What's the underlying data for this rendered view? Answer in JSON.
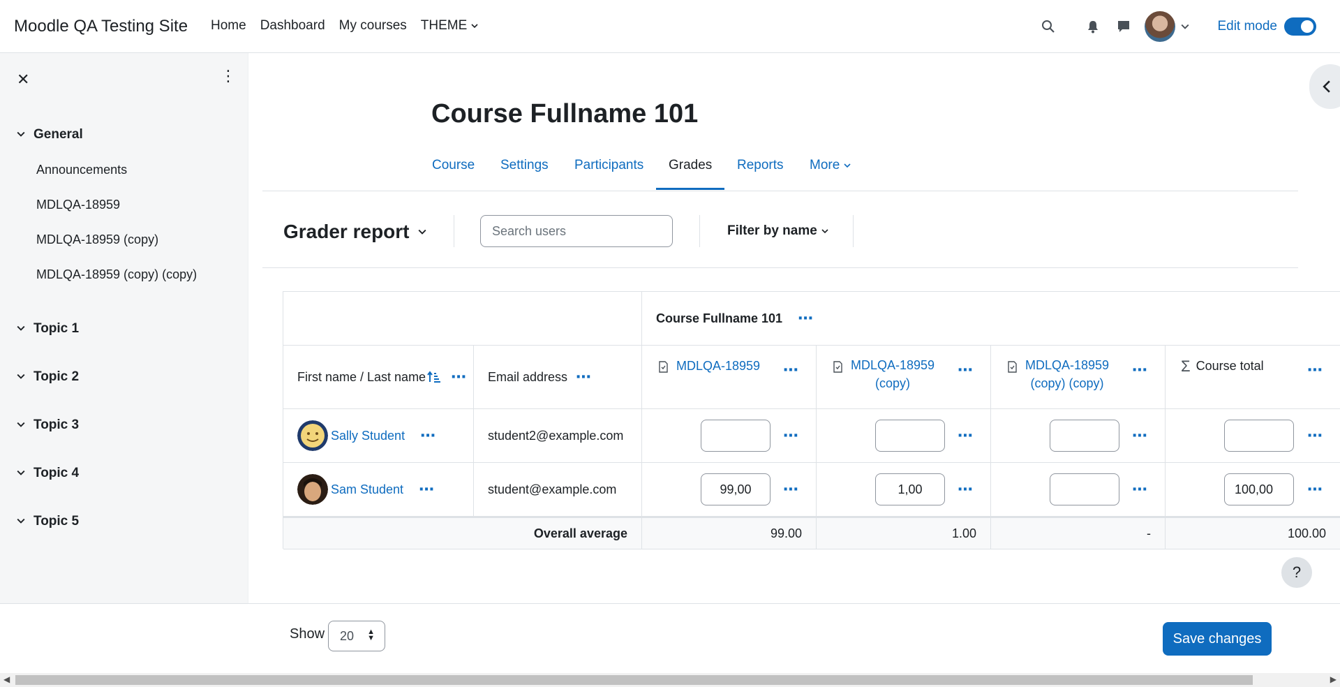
{
  "navbar": {
    "site_name": "Moodle QA Testing Site",
    "links": [
      "Home",
      "Dashboard",
      "My courses"
    ],
    "theme_label": "THEME",
    "edit_mode_label": "Edit mode",
    "edit_mode_on": true
  },
  "drawer": {
    "sections": [
      {
        "title": "General",
        "items": [
          "Announcements",
          "MDLQA-18959",
          "MDLQA-18959 (copy)",
          "MDLQA-18959 (copy) (copy)"
        ]
      },
      {
        "title": "Topic 1"
      },
      {
        "title": "Topic 2"
      },
      {
        "title": "Topic 3"
      },
      {
        "title": "Topic 4"
      },
      {
        "title": "Topic 5"
      }
    ]
  },
  "course": {
    "title": "Course Fullname 101",
    "tabs": [
      "Course",
      "Settings",
      "Participants",
      "Grades",
      "Reports",
      "More"
    ],
    "active_tab": "Grades"
  },
  "report": {
    "title": "Grader report",
    "search_placeholder": "Search users",
    "filter_label": "Filter by name"
  },
  "grader": {
    "category_header": "Course Fullname 101",
    "col_name": "First name / Last name",
    "col_email": "Email address",
    "items": [
      {
        "name": "MDLQA-18959",
        "line2": ""
      },
      {
        "name": "MDLQA-18959",
        "line2": "(copy)"
      },
      {
        "name": "MDLQA-18959",
        "line2": "(copy) (copy)"
      }
    ],
    "course_total": "Course total",
    "rows": [
      {
        "name": "Sally Student",
        "email": "student2@example.com",
        "grades": [
          "",
          "",
          "",
          ""
        ]
      },
      {
        "name": "Sam Student",
        "email": "student@example.com",
        "grades": [
          "99,00",
          "1,00",
          "",
          "100,00"
        ]
      }
    ],
    "average_label": "Overall average",
    "averages": [
      "99.00",
      "1.00",
      "-",
      "100.00"
    ]
  },
  "footer": {
    "show_label": "Show",
    "show_value": "20",
    "save_label": "Save changes"
  },
  "help": "?"
}
